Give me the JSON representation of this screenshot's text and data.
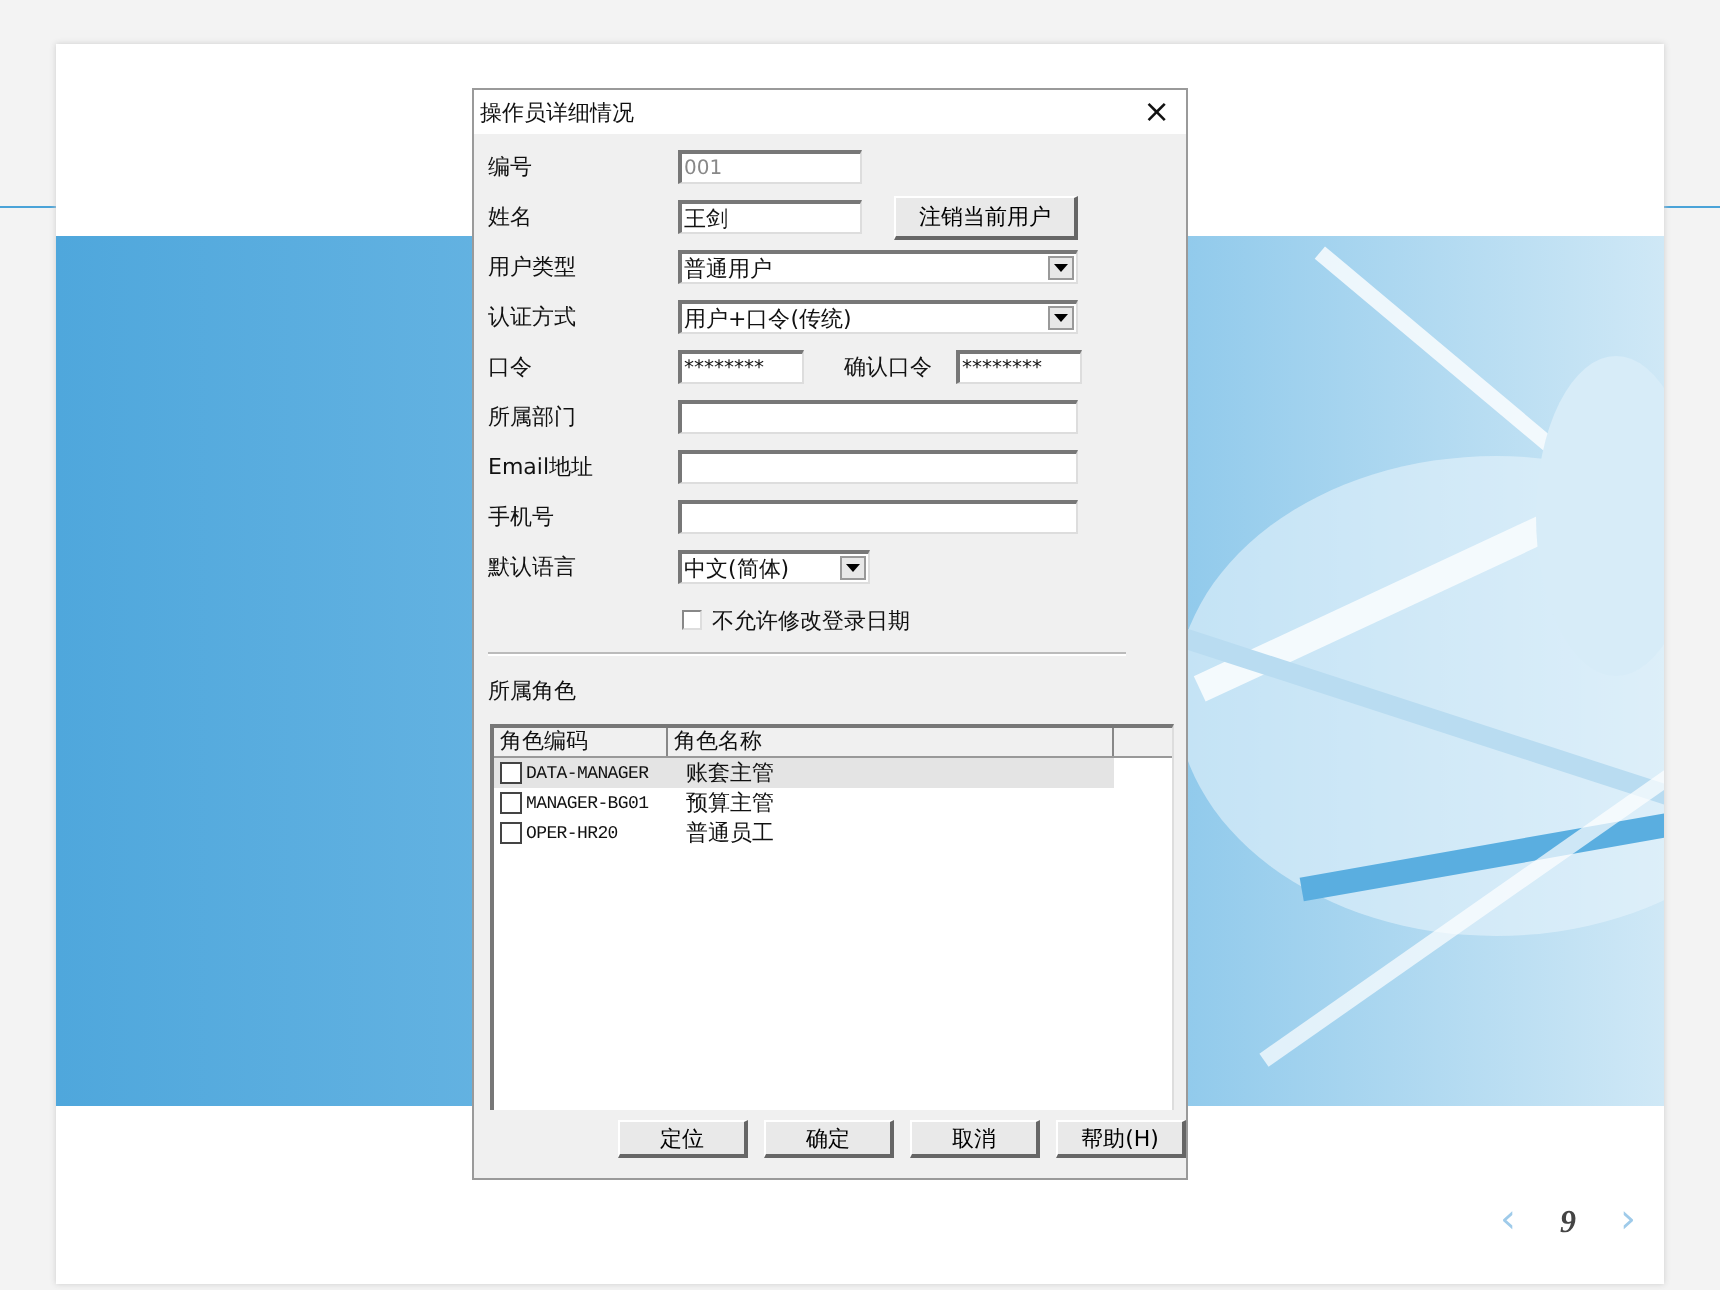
{
  "dialog": {
    "title": "操作员详细情况",
    "close": "×",
    "fields": [
      {
        "kind": "text",
        "label": "编号",
        "value": "001",
        "disabled": true
      },
      {
        "kind": "text",
        "label": "姓名",
        "value": "王剑",
        "disabled": false,
        "button": "注销当前用户"
      },
      {
        "kind": "select",
        "label": "用户类型",
        "value": "普通用户"
      },
      {
        "kind": "select",
        "label": "认证方式",
        "value": "用户+口令(传统)"
      },
      {
        "kind": "password",
        "label": "口令",
        "value": "********",
        "confirm_label": "确认口令",
        "confirm_value": "********"
      },
      {
        "kind": "text",
        "label": "所属部门",
        "disabled": false
      },
      {
        "kind": "text",
        "label": "Email地址",
        "disabled": false
      },
      {
        "kind": "text",
        "label": "手机号",
        "disabled": false
      },
      {
        "kind": "short-select",
        "label": "默认语言",
        "value": "中文(简体)"
      }
    ],
    "checkbox": {
      "label": "不允许修改登录日期",
      "checked": false
    },
    "roles": {
      "title": "所属角色",
      "columns": [
        "角色编码",
        "角色名称"
      ],
      "rows": [
        {
          "code": "DATA-MANAGER",
          "name": "账套主管",
          "checked": false,
          "selected": true
        },
        {
          "code": "MANAGER-BG01",
          "name": "预算主管",
          "checked": false,
          "selected": false
        },
        {
          "code": "OPER-HR20",
          "name": "普通员工",
          "checked": false,
          "selected": false
        }
      ]
    },
    "buttons": [
      "定位",
      "确定",
      "取消",
      "帮助(H)"
    ]
  },
  "pager": {
    "prev": "‹",
    "page": "9",
    "next": "›"
  }
}
